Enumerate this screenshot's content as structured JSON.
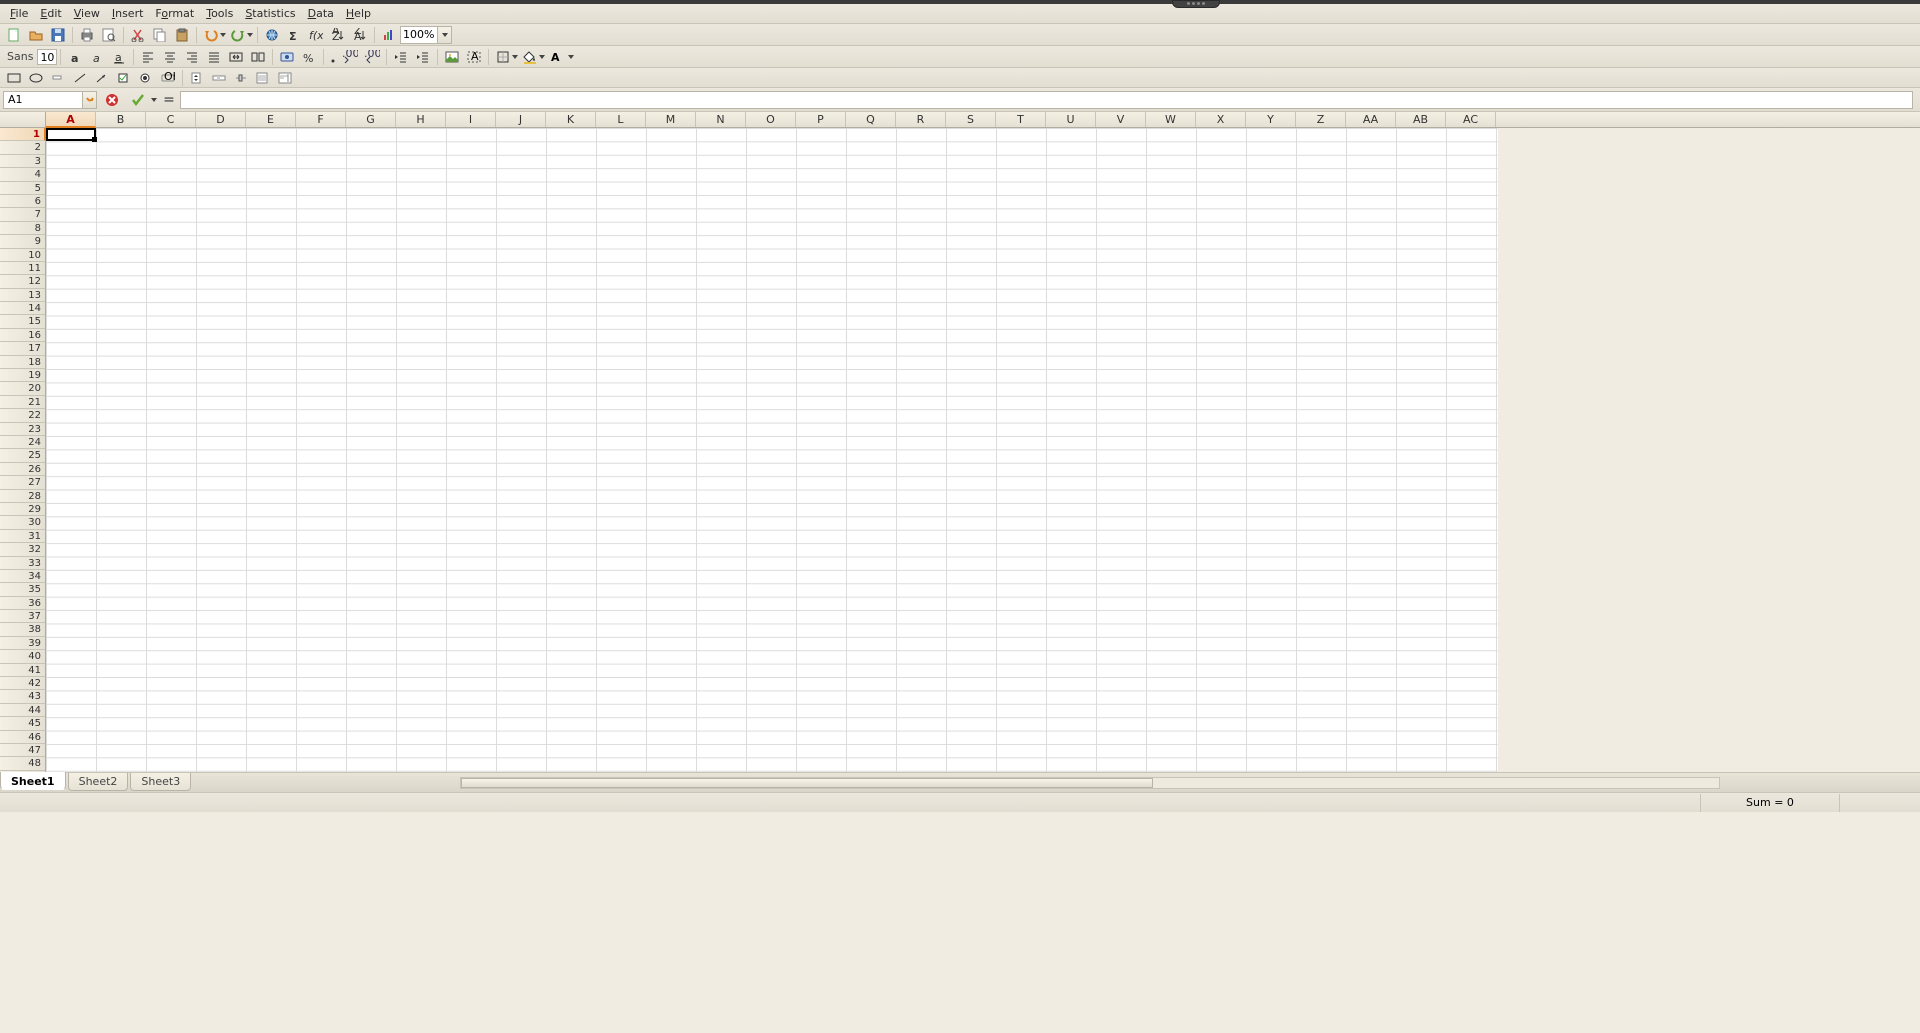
{
  "menu": {
    "items": [
      "File",
      "Edit",
      "View",
      "Insert",
      "Format",
      "Tools",
      "Statistics",
      "Data",
      "Help"
    ],
    "mnemonic": [
      "F",
      "E",
      "V",
      "I",
      "o",
      "T",
      "S",
      "D",
      "H"
    ]
  },
  "toolbar1": {
    "zoom": "100%"
  },
  "toolbar2": {
    "font": "Sans",
    "size": "10"
  },
  "cellref": {
    "ref": "A1",
    "eq": "=",
    "formula": ""
  },
  "columns": [
    "A",
    "B",
    "C",
    "D",
    "E",
    "F",
    "G",
    "H",
    "I",
    "J",
    "K",
    "L",
    "M",
    "N",
    "O",
    "P",
    "Q",
    "R",
    "S",
    "T",
    "U",
    "V",
    "W",
    "X",
    "Y",
    "Z",
    "AA",
    "AB",
    "AC"
  ],
  "rows": 48,
  "active": {
    "col": 0,
    "row": 0
  },
  "tabs": [
    "Sheet1",
    "Sheet2",
    "Sheet3"
  ],
  "active_tab": 0,
  "status": {
    "sum": "Sum = 0"
  }
}
